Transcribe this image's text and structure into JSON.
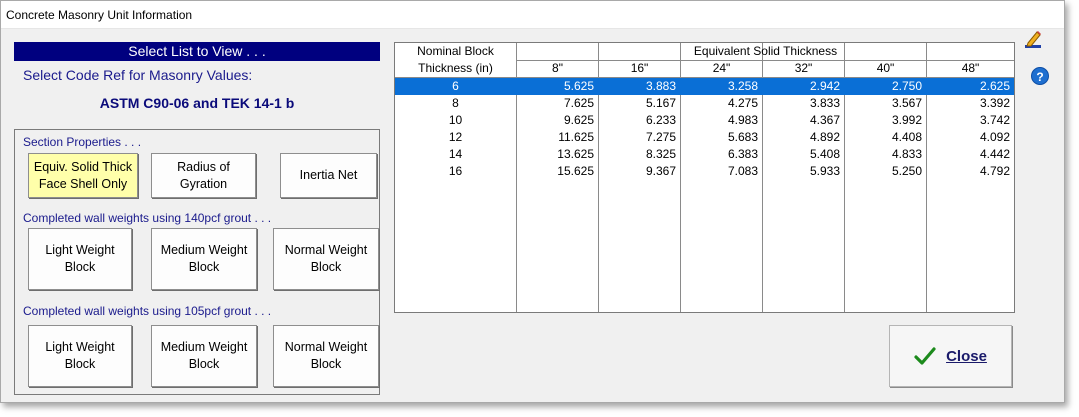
{
  "window": {
    "title": "Concrete Masonry Unit Information"
  },
  "left": {
    "select_header": "Select List to View . . .",
    "code_ref_label": "Select Code Ref for Masonry Values:",
    "code_ref_value": "ASTM C90-06 and TEK 14-1 b"
  },
  "section": {
    "label": "Section Properties . . .",
    "equiv": "Equiv. Solid Thick\nFace Shell Only",
    "radius": "Radius of\nGyration",
    "inertia": "Inertia Net"
  },
  "grout140": {
    "label": "Completed wall weights using 140pcf grout . . .",
    "light": "Light Weight\nBlock",
    "medium": "Medium Weight\nBlock",
    "normal": "Normal Weight\nBlock"
  },
  "grout105": {
    "label": "Completed wall weights using 105pcf grout . . .",
    "light": "Light Weight\nBlock",
    "medium": "Medium Weight\nBlock",
    "normal": "Normal Weight\nBlock"
  },
  "table": {
    "header_nominal": "Nominal Block",
    "header_equiv": "Equivalent Solid Thickness",
    "header_thickness": "Thickness  (in)",
    "columns": [
      "8\"",
      "16\"",
      "24\"",
      "32\"",
      "40\"",
      "48\""
    ],
    "rows": [
      [
        "6",
        "5.625",
        "3.883",
        "3.258",
        "2.942",
        "2.750",
        "2.625"
      ],
      [
        "8",
        "7.625",
        "5.167",
        "4.275",
        "3.833",
        "3.567",
        "3.392"
      ],
      [
        "10",
        "9.625",
        "6.233",
        "4.983",
        "4.367",
        "3.992",
        "3.742"
      ],
      [
        "12",
        "11.625",
        "7.275",
        "5.683",
        "4.892",
        "4.408",
        "4.092"
      ],
      [
        "14",
        "13.625",
        "8.325",
        "6.383",
        "5.408",
        "4.833",
        "4.442"
      ],
      [
        "16",
        "15.625",
        "9.367",
        "7.083",
        "5.933",
        "5.250",
        "4.792"
      ]
    ],
    "selected_row": 0
  },
  "close": {
    "label": "Close",
    "icon": "checkmark-icon"
  },
  "icons": {
    "edit": "pencil-icon",
    "help": "?"
  },
  "colors": {
    "header_bg": "#00007f",
    "selected_row": "#0a6fd6",
    "active_button": "#ffffaa",
    "label_text": "#1a1a8c"
  }
}
